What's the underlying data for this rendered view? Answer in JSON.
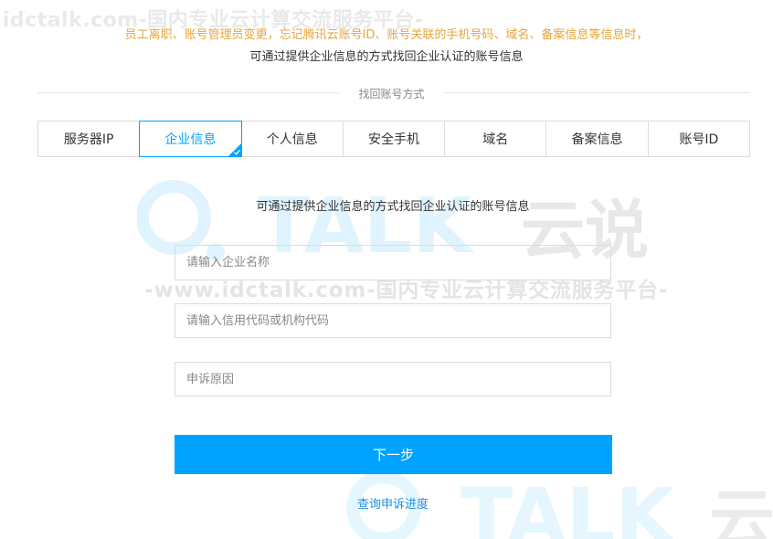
{
  "watermark": {
    "top_text": ".idctalk.com-国内专业云计算交流服务平台-",
    "mid_text": "-www.idctalk.com-国内专业云计算交流服务平台-",
    "logo_word": "TALK",
    "logo_cn": "云说",
    "logo_cn_partial": "云"
  },
  "notice": {
    "line1": "员工离职、账号管理员变更，忘记腾讯云账号ID、账号关联的手机号码、域名、备案信息等信息时，",
    "line2": "可通过提供企业信息的方式找回企业认证的账号信息"
  },
  "method_caption": "找回账号方式",
  "tabs": [
    {
      "label": "服务器IP"
    },
    {
      "label": "企业信息"
    },
    {
      "label": "个人信息"
    },
    {
      "label": "安全手机"
    },
    {
      "label": "域名"
    },
    {
      "label": "备案信息"
    },
    {
      "label": "账号ID"
    }
  ],
  "form": {
    "title": "可通过提供企业信息的方式找回企业认证的账号信息",
    "company_placeholder": "请输入企业名称",
    "credit_placeholder": "请输入信用代码或机构代码",
    "reason_placeholder": "申诉原因",
    "next_label": "下一步",
    "progress_link": "查询申诉进度"
  },
  "colors": {
    "accent": "#00a3ff",
    "notice_orange": "#e8a53a",
    "link_blue": "#1a8fe8"
  }
}
